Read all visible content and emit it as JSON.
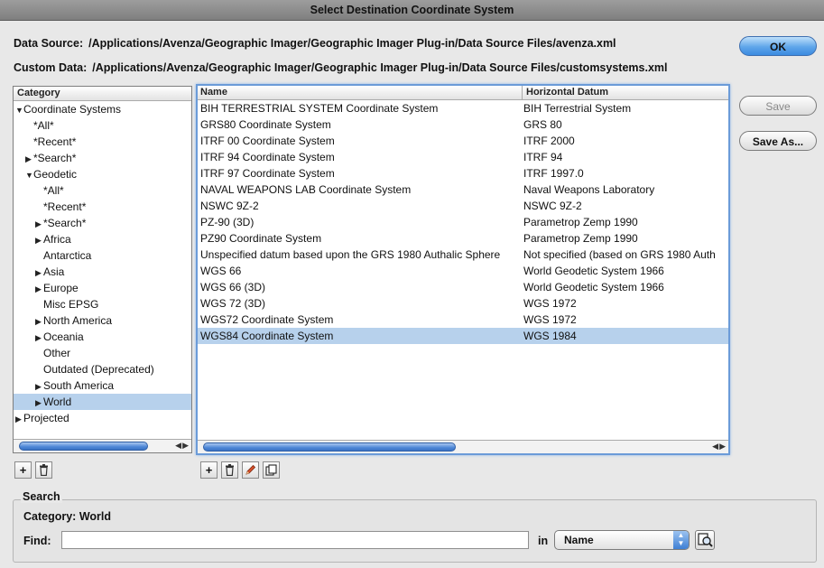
{
  "window": {
    "title": "Select Destination Coordinate System"
  },
  "data_source": {
    "label": "Data Source:",
    "path": "/Applications/Avenza/Geographic Imager/Geographic Imager Plug-in/Data Source Files/avenza.xml"
  },
  "custom_data": {
    "label": "Custom Data:",
    "path": "/Applications/Avenza/Geographic Imager/Geographic Imager Plug-in/Data Source Files/customsystems.xml"
  },
  "buttons": {
    "ok": "OK",
    "save": "Save",
    "save_as": "Save As..."
  },
  "category": {
    "header": "Category",
    "items": [
      {
        "label": "Coordinate Systems",
        "arrow": "▼",
        "indent": 0
      },
      {
        "label": "*All*",
        "arrow": "",
        "indent": 1
      },
      {
        "label": "*Recent*",
        "arrow": "",
        "indent": 1
      },
      {
        "label": "*Search*",
        "arrow": "▶",
        "indent": 1
      },
      {
        "label": "Geodetic",
        "arrow": "▼",
        "indent": 1
      },
      {
        "label": "*All*",
        "arrow": "",
        "indent": 2
      },
      {
        "label": "*Recent*",
        "arrow": "",
        "indent": 2
      },
      {
        "label": "*Search*",
        "arrow": "▶",
        "indent": 2
      },
      {
        "label": "Africa",
        "arrow": "▶",
        "indent": 2
      },
      {
        "label": "Antarctica",
        "arrow": "",
        "indent": 2
      },
      {
        "label": "Asia",
        "arrow": "▶",
        "indent": 2
      },
      {
        "label": "Europe",
        "arrow": "▶",
        "indent": 2
      },
      {
        "label": "Misc EPSG",
        "arrow": "",
        "indent": 2
      },
      {
        "label": "North America",
        "arrow": "▶",
        "indent": 2
      },
      {
        "label": "Oceania",
        "arrow": "▶",
        "indent": 2
      },
      {
        "label": "Other",
        "arrow": "",
        "indent": 2
      },
      {
        "label": "Outdated (Deprecated)",
        "arrow": "",
        "indent": 2
      },
      {
        "label": "South America",
        "arrow": "▶",
        "indent": 2
      },
      {
        "label": "World",
        "arrow": "▶",
        "indent": 2,
        "selected": true
      },
      {
        "label": "Projected",
        "arrow": "▶",
        "indent": 0
      }
    ]
  },
  "systems": {
    "headers": {
      "name": "Name",
      "datum": "Horizontal Datum"
    },
    "rows": [
      {
        "name": "BIH TERRESTRIAL SYSTEM Coordinate System",
        "datum": "BIH Terrestrial System"
      },
      {
        "name": "GRS80 Coordinate System",
        "datum": "GRS 80"
      },
      {
        "name": "ITRF 00 Coordinate System",
        "datum": "ITRF 2000"
      },
      {
        "name": "ITRF 94 Coordinate System",
        "datum": "ITRF 94"
      },
      {
        "name": "ITRF 97 Coordinate System",
        "datum": "ITRF 1997.0"
      },
      {
        "name": "NAVAL WEAPONS LAB Coordinate System",
        "datum": "Naval Weapons Laboratory"
      },
      {
        "name": "NSWC 9Z-2",
        "datum": "NSWC 9Z-2"
      },
      {
        "name": "PZ-90 (3D)",
        "datum": "Parametrop Zemp 1990"
      },
      {
        "name": "PZ90 Coordinate System",
        "datum": "Parametrop Zemp 1990"
      },
      {
        "name": "Unspecified datum based upon the GRS 1980 Authalic Sphere",
        "datum": "Not specified (based on GRS 1980 Auth"
      },
      {
        "name": "WGS 66",
        "datum": "World Geodetic System 1966"
      },
      {
        "name": "WGS 66 (3D)",
        "datum": "World Geodetic System 1966"
      },
      {
        "name": "WGS 72 (3D)",
        "datum": "WGS 1972"
      },
      {
        "name": "WGS72 Coordinate System",
        "datum": "WGS 1972"
      },
      {
        "name": "WGS84 Coordinate System",
        "datum": "WGS 1984",
        "selected": true
      }
    ]
  },
  "toolbars": {
    "category": [
      {
        "icon": "plus-icon",
        "glyph": "+"
      },
      {
        "icon": "trash-icon",
        "glyph": ""
      }
    ],
    "list": [
      {
        "icon": "plus-icon",
        "glyph": "+"
      },
      {
        "icon": "trash-icon",
        "glyph": ""
      },
      {
        "icon": "pencil-icon",
        "glyph": ""
      },
      {
        "icon": "duplicate-icon",
        "glyph": ""
      }
    ]
  },
  "search": {
    "legend": "Search",
    "category_text": "Category: World",
    "find_label": "Find:",
    "find_value": "",
    "in_label": "in",
    "in_selected": "Name"
  },
  "colors": {
    "selection": "#b7d1ec",
    "accent": "#3b8ae0"
  }
}
